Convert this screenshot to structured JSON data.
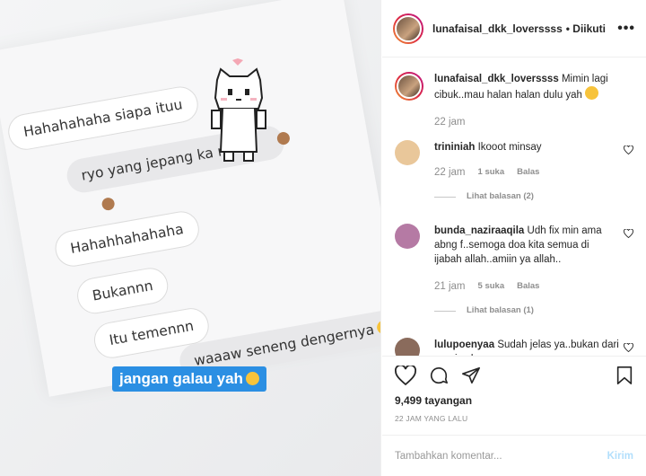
{
  "post": {
    "chat_bubbles": [
      "Hahahahaha siapa ituu",
      "ryo yang jepang ka m",
      "Hahahhahahaha",
      "Bukannn",
      "Itu temennn",
      "waaaw seneng dengernya"
    ],
    "caption_overlay": "jangan galau yah"
  },
  "header": {
    "username": "lunafaisal_dkk_loverssss",
    "follow_status": "• Diikuti",
    "more_icon": "more-horizontal-icon"
  },
  "caption": {
    "username": "lunafaisal_dkk_loverssss",
    "text": "Mimin lagi cibuk..mau halan halan dulu yah",
    "time": "22 jam"
  },
  "comments": [
    {
      "username": "trininiah",
      "text": "Ikooot minsay",
      "time": "22 jam",
      "likes": "1 suka",
      "reply": "Balas",
      "view_replies": "Lihat balasan (2)",
      "avatar_color": "#e9c79a"
    },
    {
      "username": "bunda_naziraaqila",
      "text": "Udh fix min ama abng f..semoga doa kita semua di ijabah allah..amiin ya allah..",
      "time": "21 jam",
      "likes": "5 suka",
      "reply": "Balas",
      "view_replies": "Lihat balasan (1)",
      "avatar_color": "#b57aa4"
    },
    {
      "username": "lulupoenyaa",
      "text": "Sudah jelas ya..bukan dari negri sakura",
      "avatar_color": "#8a6b5c"
    }
  ],
  "actions": {
    "views": "9,499 tayangan",
    "posted_ago": "22 JAM YANG LALU"
  },
  "add_comment": {
    "placeholder": "Tambahkan komentar...",
    "send_label": "Kirim"
  }
}
